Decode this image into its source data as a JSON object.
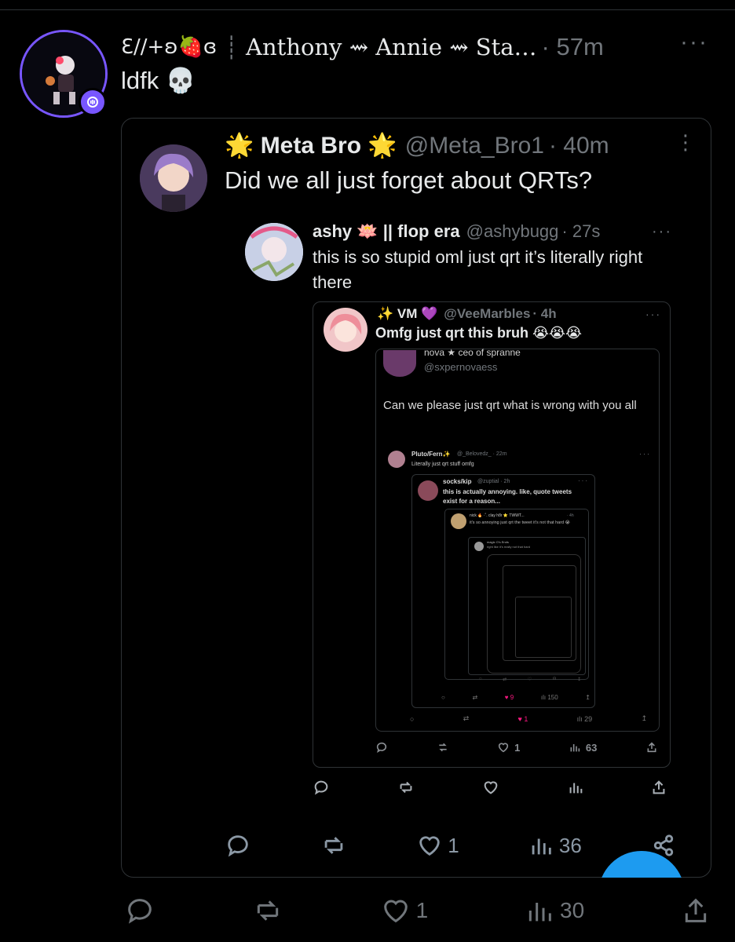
{
  "main_post": {
    "display_name": "Ɛ//+ʚ🍓ɞ",
    "name_rest": "Anthony ⇝ Annie ⇝ Sta…",
    "time": "· 57m",
    "text": "ldfk 💀",
    "actions": {
      "reply": "",
      "repost": "",
      "likes": "1",
      "views": "30"
    }
  },
  "quote1": {
    "display_name": "🌟 Meta Bro 🌟",
    "handle": "@Meta_Bro1",
    "time": "· 40m",
    "text": "Did we all just forget about QRTs?",
    "actions": {
      "likes": "1",
      "views": "36"
    }
  },
  "quote2": {
    "display_name": "ashy 🪷 || flop era",
    "handle": "@ashybugg",
    "time": "· 27s",
    "text": "this is so stupid oml just qrt it’s literally right there"
  },
  "quote3": {
    "display_name": "✨ VM 💜",
    "handle": "@VeeMarbles",
    "time": "· 4h",
    "text": "Omfg just qrt this bruh 😭😭😭",
    "actions": {
      "likes": "1",
      "views": "63"
    }
  },
  "quote4": {
    "display_name": "nova ★ ceo of spranne",
    "handle": "@sxpernovaess",
    "text": "Can we please just qrt what is wrong with you all",
    "actions": {
      "likes": "1",
      "views": "29"
    }
  },
  "quote5": {
    "display_name": "Pluto/Fern✨",
    "handle": "@_Belovedz_ · 22m",
    "text": "Literally just qrt stuff omfg",
    "actions": {
      "likes": "9",
      "views": "150"
    }
  },
  "quote6": {
    "display_name": "socks/kip",
    "handle": "@zuptial · 2h",
    "text": "this is actually annoying. like, quote tweets exist for a reason..."
  },
  "quote7": {
    "display_name": "nick 🔥 ·˚. clay h8r ⭐ TWWT...",
    "time": "· 4h",
    "text": "it's so annoying just qrt the tweet it's not that hard 😭"
  },
  "quote8": {
    "display_name": "magic O's Ends",
    "text": "right like it's really not that hard"
  },
  "colors": {
    "bg": "#000000",
    "text": "#e7e9ea",
    "muted": "#71767b",
    "accent": "#1d9bf0",
    "border": "#2f3336",
    "badge": "#7856ff"
  }
}
